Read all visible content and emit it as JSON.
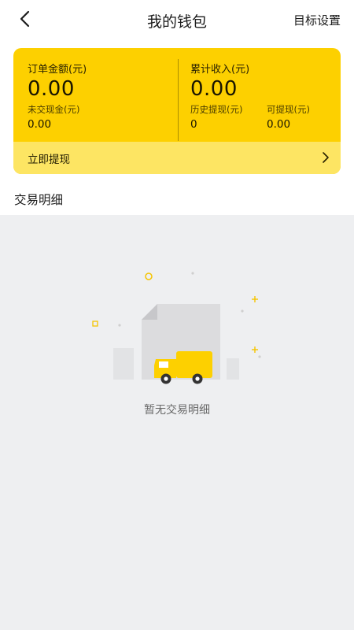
{
  "header": {
    "title": "我的钱包",
    "right_action": "目标设置",
    "back_icon": "chevron-left-icon"
  },
  "wallet": {
    "order_amount_label": "订单金额(元)",
    "order_amount_value": "0.00",
    "uncashed_label": "未交现金(元)",
    "uncashed_value": "0.00",
    "total_income_label": "累计收入(元)",
    "total_income_value": "0.00",
    "history_withdraw_label": "历史提现(元)",
    "history_withdraw_value": "0",
    "withdrawable_label": "可提现(元)",
    "withdrawable_value": "0.00",
    "withdraw_now_label": "立即提现",
    "card_color": "#fdd000",
    "bar_color": "#fde563"
  },
  "transactions": {
    "section_title": "交易明细",
    "empty_text": "暂无交易明细",
    "empty_icon": "delivery-truck-document-icon"
  }
}
